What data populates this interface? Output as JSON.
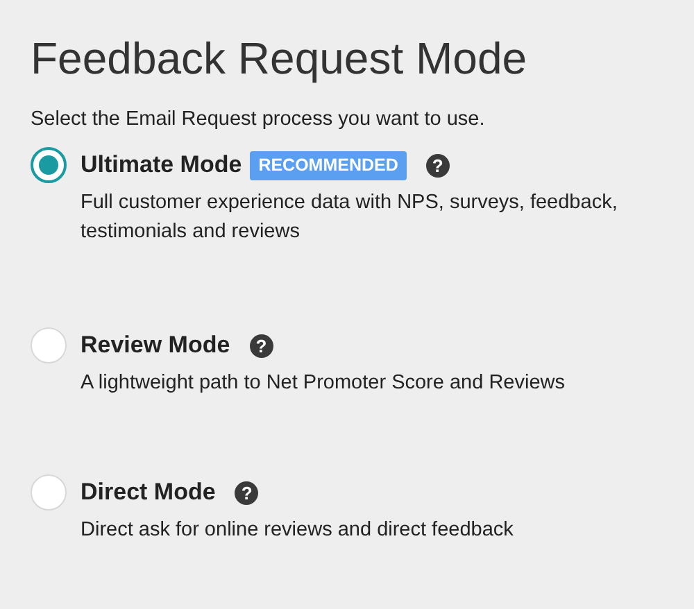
{
  "title": "Feedback Request Mode",
  "subtitle": "Select the Email Request process you want to use.",
  "options": [
    {
      "label": "Ultimate Mode",
      "badge": "RECOMMENDED",
      "help": "?",
      "description": "Full customer experience data with NPS, surveys, feedback, testimonials and reviews",
      "selected": true
    },
    {
      "label": "Review Mode",
      "help": "?",
      "description": "A lightweight path to Net Promoter Score and Reviews",
      "selected": false
    },
    {
      "label": "Direct Mode",
      "help": "?",
      "description": "Direct ask for online reviews and direct feedback",
      "selected": false
    }
  ]
}
